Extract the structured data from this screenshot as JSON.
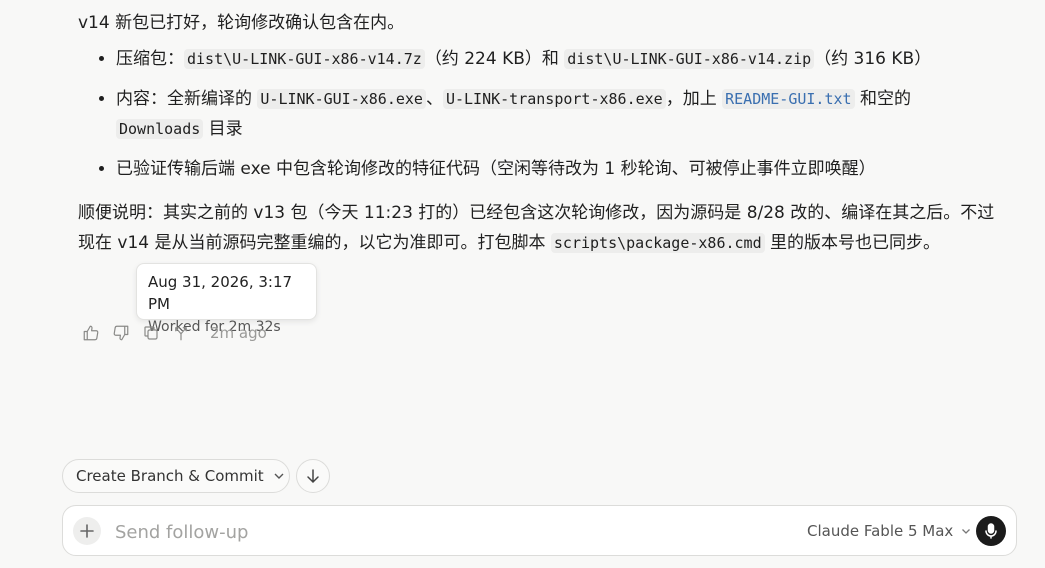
{
  "message": {
    "intro": "v14 新包已打好，轮询修改确认包含在内。",
    "bullets": [
      {
        "prefix": "压缩包：",
        "code1": "dist\\U-LINK-GUI-x86-v14.7z",
        "mid": "（约 224 KB）和 ",
        "code2": "dist\\U-LINK-GUI-x86-v14.zip",
        "suffix": "（约 316 KB）"
      },
      {
        "prefix": "内容：全新编译的 ",
        "code1": "U-LINK-GUI-x86.exe",
        "sep1": "、",
        "code2": "U-LINK-transport-x86.exe",
        "sep2": "，加上 ",
        "link": "README-GUI.txt",
        "sep3": " 和空的",
        "code3": "Downloads",
        "suffix": " 目录"
      },
      {
        "text": "已验证传输后端 exe 中包含轮询修改的特征代码（空闲等待改为 1 秒轮询、可被停止事件立即唤醒）"
      }
    ],
    "para2_start": "顺便说明：其实之前的 v13 包（今天 11:23 打的）已经包含这次轮询修改，因为源码是 8/28 改的、编译在其之后。不过现在 v14 是从当前源码完整重编的，以它为准即可。打包脚本 ",
    "para2_code": "scripts\\package-x86.cmd",
    "para2_end": " 里的版本号也已同步。"
  },
  "tooltip": {
    "date": "Aug 31, 2026, 3:17 PM",
    "worked": "Worked for 2m 32s"
  },
  "actions": {
    "icons": [
      "thumbs-up-icon",
      "thumbs-down-icon",
      "copy-icon",
      "branch-icon"
    ],
    "time_ago": "2m ago"
  },
  "branch_button": {
    "label": "Create Branch & Commit"
  },
  "composer": {
    "placeholder": "Send follow-up",
    "model": "Claude Fable 5 Max"
  }
}
